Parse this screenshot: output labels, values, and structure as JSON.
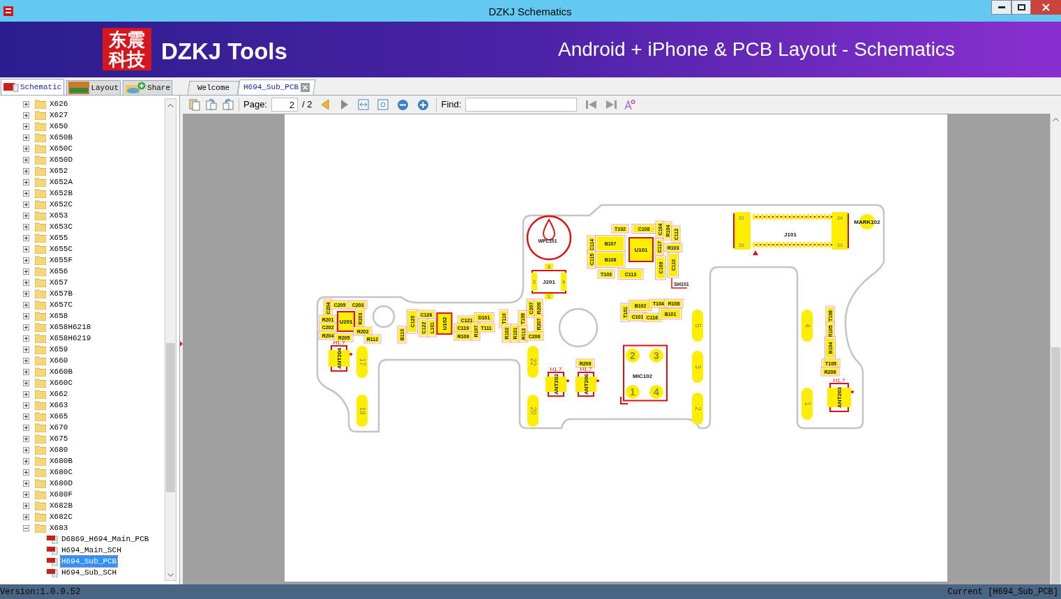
{
  "window": {
    "title": "DZKJ Schematics"
  },
  "banner": {
    "logo_lines": [
      "东震",
      "科技"
    ],
    "brand": "DZKJ Tools",
    "tagline": "Android + iPhone & PCB Layout - Schematics"
  },
  "panel_tabs": [
    {
      "label": "Schematic",
      "selected": true
    },
    {
      "label": "Layout",
      "selected": false
    },
    {
      "label": "Share",
      "selected": false
    }
  ],
  "doc_tabs": [
    {
      "label": "Welcome",
      "selected": false,
      "closable": false
    },
    {
      "label": "H694_Sub_PCB",
      "selected": true,
      "closable": true
    }
  ],
  "tree": {
    "items": [
      {
        "label": "X626",
        "expanded": false,
        "selected": false
      },
      {
        "label": "X627",
        "expanded": false,
        "selected": false
      },
      {
        "label": "X650",
        "expanded": false,
        "selected": false
      },
      {
        "label": "X650B",
        "expanded": false,
        "selected": false
      },
      {
        "label": "X650C",
        "expanded": false,
        "selected": false
      },
      {
        "label": "X650D",
        "expanded": false,
        "selected": false
      },
      {
        "label": "X652",
        "expanded": false,
        "selected": false
      },
      {
        "label": "X652A",
        "expanded": false,
        "selected": false
      },
      {
        "label": "X652B",
        "expanded": false,
        "selected": false
      },
      {
        "label": "X652C",
        "expanded": false,
        "selected": false
      },
      {
        "label": "X653",
        "expanded": false,
        "selected": false
      },
      {
        "label": "X653C",
        "expanded": false,
        "selected": false
      },
      {
        "label": "X655",
        "expanded": false,
        "selected": false
      },
      {
        "label": "X655C",
        "expanded": false,
        "selected": false
      },
      {
        "label": "X655F",
        "expanded": false,
        "selected": false
      },
      {
        "label": "X656",
        "expanded": false,
        "selected": false
      },
      {
        "label": "X657",
        "expanded": false,
        "selected": false
      },
      {
        "label": "X657B",
        "expanded": false,
        "selected": false
      },
      {
        "label": "X657C",
        "expanded": false,
        "selected": false
      },
      {
        "label": "X658",
        "expanded": false,
        "selected": false
      },
      {
        "label": "X658H6218",
        "expanded": false,
        "selected": false
      },
      {
        "label": "X658H6219",
        "expanded": false,
        "selected": false
      },
      {
        "label": "X659",
        "expanded": false,
        "selected": false
      },
      {
        "label": "X660",
        "expanded": false,
        "selected": false
      },
      {
        "label": "X660B",
        "expanded": false,
        "selected": false
      },
      {
        "label": "X660C",
        "expanded": false,
        "selected": false
      },
      {
        "label": "X662",
        "expanded": false,
        "selected": false
      },
      {
        "label": "X663",
        "expanded": false,
        "selected": false
      },
      {
        "label": "X665",
        "expanded": false,
        "selected": false
      },
      {
        "label": "X670",
        "expanded": false,
        "selected": false
      },
      {
        "label": "X675",
        "expanded": false,
        "selected": false
      },
      {
        "label": "X680",
        "expanded": false,
        "selected": false
      },
      {
        "label": "X680B",
        "expanded": false,
        "selected": false
      },
      {
        "label": "X680C",
        "expanded": false,
        "selected": false
      },
      {
        "label": "X680D",
        "expanded": false,
        "selected": false
      },
      {
        "label": "X680F",
        "expanded": false,
        "selected": false
      },
      {
        "label": "X682B",
        "expanded": false,
        "selected": false
      },
      {
        "label": "X682C",
        "expanded": false,
        "selected": false
      },
      {
        "label": "X683",
        "expanded": true,
        "selected": false,
        "children": [
          {
            "label": "D6869_H694_Main_PCB",
            "selected": false
          },
          {
            "label": "H694_Main_SCH",
            "selected": false
          },
          {
            "label": "H694_Sub_PCB",
            "selected": true
          },
          {
            "label": "H694_Sub_SCH",
            "selected": false
          }
        ]
      }
    ]
  },
  "toolbar": {
    "page_label": "Page:",
    "page_value": "2",
    "page_total": "/ 2",
    "find_label": "Find:"
  },
  "pcb": {
    "components": [
      {
        "label": "C204"
      },
      {
        "label": "C205"
      },
      {
        "label": "C203"
      },
      {
        "label": "R201"
      },
      {
        "label": "U201"
      },
      {
        "label": "R203"
      },
      {
        "label": "C202"
      },
      {
        "label": "R202"
      },
      {
        "label": "R204"
      },
      {
        "label": "R205"
      },
      {
        "label": "R112"
      },
      {
        "label": "ANT204",
        "marker": "H1.7"
      },
      {
        "label": "B110"
      },
      {
        "label": "C120"
      },
      {
        "label": "C126"
      },
      {
        "label": "C122"
      },
      {
        "label": "L101"
      },
      {
        "label": "U102"
      },
      {
        "label": "C121"
      },
      {
        "label": "D101"
      },
      {
        "label": "C119"
      },
      {
        "label": "R109"
      },
      {
        "label": "R107"
      },
      {
        "label": "T111"
      },
      {
        "label": "T110"
      },
      {
        "label": "R102"
      },
      {
        "label": "R101"
      },
      {
        "label": "T109"
      },
      {
        "label": "R113"
      },
      {
        "label": "C207"
      },
      {
        "label": "R206"
      },
      {
        "label": "R207"
      },
      {
        "label": "C206"
      },
      {
        "label": "WPL101"
      },
      {
        "label": "J201",
        "pins": [
          "3",
          "2",
          "4",
          "1"
        ]
      },
      {
        "label": "T102"
      },
      {
        "label": "C108"
      },
      {
        "label": "C104"
      },
      {
        "label": "R104"
      },
      {
        "label": "C112"
      },
      {
        "label": "C114"
      },
      {
        "label": "B107"
      },
      {
        "label": "U101"
      },
      {
        "label": "C117"
      },
      {
        "label": "R103"
      },
      {
        "label": "C115"
      },
      {
        "label": "B108"
      },
      {
        "label": "C109"
      },
      {
        "label": "C110"
      },
      {
        "label": "T103"
      },
      {
        "label": "C113"
      },
      {
        "label": "SH101"
      },
      {
        "label": "T101"
      },
      {
        "label": "B102"
      },
      {
        "label": "T104"
      },
      {
        "label": "R108"
      },
      {
        "label": "C101"
      },
      {
        "label": "C116"
      },
      {
        "label": "B101"
      },
      {
        "label": "R209"
      },
      {
        "label": "ANT202",
        "marker": "H1.7"
      },
      {
        "label": "ANT206",
        "marker": "H1.7"
      },
      {
        "label": "MIC102",
        "pins": [
          "2",
          "3",
          "1",
          "4"
        ]
      },
      {
        "label": "J101",
        "pins": [
          "31",
          "34",
          "32",
          "33"
        ]
      },
      {
        "label": "MARK102"
      },
      {
        "label": "T106"
      },
      {
        "label": "R105"
      },
      {
        "label": "B104"
      },
      {
        "label": "T105"
      },
      {
        "label": "R208"
      },
      {
        "label": "ANT203",
        "marker": "H1.7"
      }
    ],
    "pads": [
      {
        "label": "17"
      },
      {
        "label": "19"
      },
      {
        "label": "22"
      },
      {
        "label": "20"
      },
      {
        "label": "5"
      },
      {
        "label": "3"
      },
      {
        "label": "2"
      },
      {
        "label": "4"
      },
      {
        "label": "1"
      }
    ]
  },
  "status_bar": {
    "version": "Version:1.0.0.52",
    "current": "Current [H694_Sub_PCB]"
  }
}
